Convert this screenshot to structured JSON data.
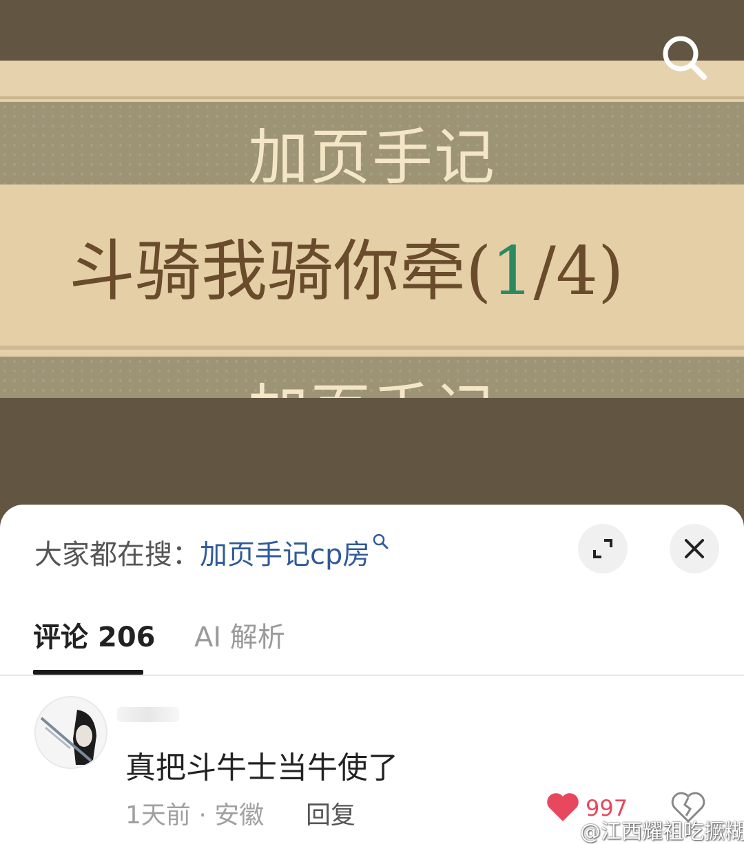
{
  "media": {
    "image_title_top": "加页手记",
    "image_main_prefix": "斗骑我骑你牵(",
    "image_main_highlight": "1",
    "image_main_suffix": "/4)",
    "image_title_bottom": "加页手记"
  },
  "sheet": {
    "search_label": "大家都在搜：",
    "search_keyword": "加页手记cp房",
    "tabs": [
      {
        "label": "评论",
        "count": "206"
      },
      {
        "label": "AI 解析"
      }
    ],
    "comment": {
      "text": "真把斗牛士当牛使了",
      "meta": "1天前 · 安徽",
      "reply_label": "回复",
      "like_count": "997"
    },
    "watermark": "@江西耀祖吃撅糊"
  },
  "colors": {
    "background": "#625542",
    "link": "#2f5a9a",
    "like": "#e8485e"
  },
  "icons": [
    "search-icon",
    "expand-icon",
    "close-icon",
    "heart-icon",
    "broken-heart-icon",
    "weibo-icon"
  ]
}
